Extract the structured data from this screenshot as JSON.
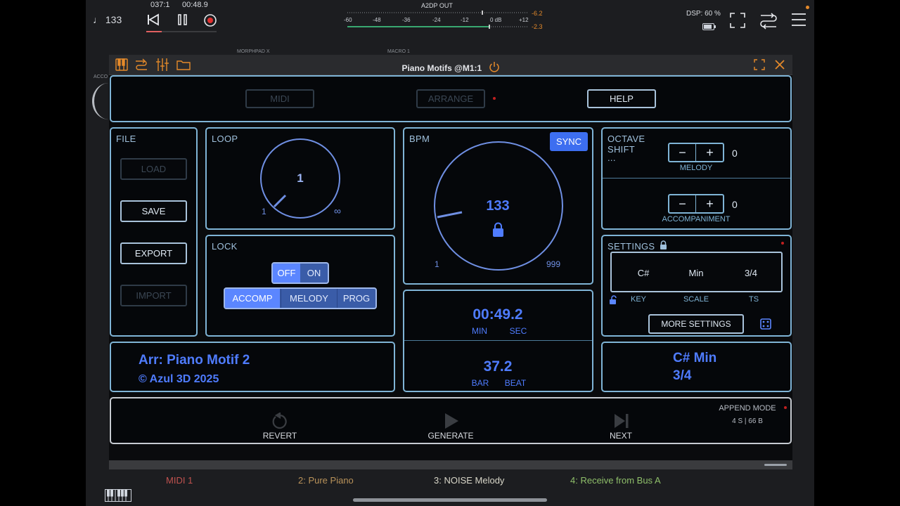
{
  "topbar": {
    "tempo": "♩ 133",
    "position": "037:1",
    "time": "00:48.9",
    "output_label": "A2DP OUT",
    "meter_ticks": [
      "-60",
      "-48",
      "-36",
      "-24",
      "-12",
      "0 dB",
      "+12"
    ],
    "peak_top": "-6.2",
    "peak_bottom": "-2.3",
    "dsp": "DSP: 60 %"
  },
  "background_labels": {
    "morph": "MORPHPAD X",
    "macro": "MACRO 1",
    "acc": "ACCO"
  },
  "window": {
    "title": "Piano Motifs @M1:1",
    "top_tabs": {
      "midi": "MIDI",
      "arrange": "ARRANGE",
      "help": "HELP"
    },
    "file": {
      "label": "FILE",
      "load": "LOAD",
      "save": "SAVE",
      "export": "EXPORT",
      "import": "IMPORT"
    },
    "loop": {
      "label": "LOOP",
      "value": "1",
      "min": "1",
      "max": "∞"
    },
    "lock": {
      "label": "LOCK",
      "off": "OFF",
      "on": "ON",
      "accomp": "ACCOMP",
      "melody": "MELODY",
      "prog": "PROG"
    },
    "bpm": {
      "label": "BPM",
      "sync": "SYNC",
      "value": "133",
      "min": "1",
      "max": "999"
    },
    "octave": {
      "label_line1": "OCTAVE",
      "label_line2": "SHIFT",
      "label_line3": "...",
      "minus": "−",
      "plus": "+",
      "melody_value": "0",
      "melody_label": "MELODY",
      "accomp_value": "0",
      "accomp_label": "ACCOMPANIMENT"
    },
    "settings": {
      "label": "SETTINGS",
      "key": "C#",
      "scale": "Min",
      "ts": "3/4",
      "key_label": "KEY",
      "scale_label": "SCALE",
      "ts_label": "TS",
      "more": "MORE SETTINGS"
    },
    "clock": {
      "time": "00:49.2",
      "min": "MIN",
      "sec": "SEC",
      "bar_beat": "37.2",
      "bar": "BAR",
      "beat": "BEAT"
    },
    "arr": {
      "name": "Arr: Piano Motif 2",
      "copyright": "© Azul 3D 2025"
    },
    "keyinfo": {
      "key_scale": "C# Min",
      "ts": "3/4"
    },
    "actions": {
      "revert": "REVERT",
      "generate": "GENERATE",
      "next": "NEXT",
      "append_mode": "APPEND MODE",
      "append_info": "4 S | 66 B"
    }
  },
  "bottom_tabs": [
    "MIDI 1",
    "2: Pure Piano",
    "3: NOISE Melody",
    "4: Receive from Bus A"
  ],
  "colors": {
    "accent": "#4f7cff",
    "panel_border": "#7fb4d6",
    "orange": "#e58a2a",
    "record_red": "#e03030"
  }
}
